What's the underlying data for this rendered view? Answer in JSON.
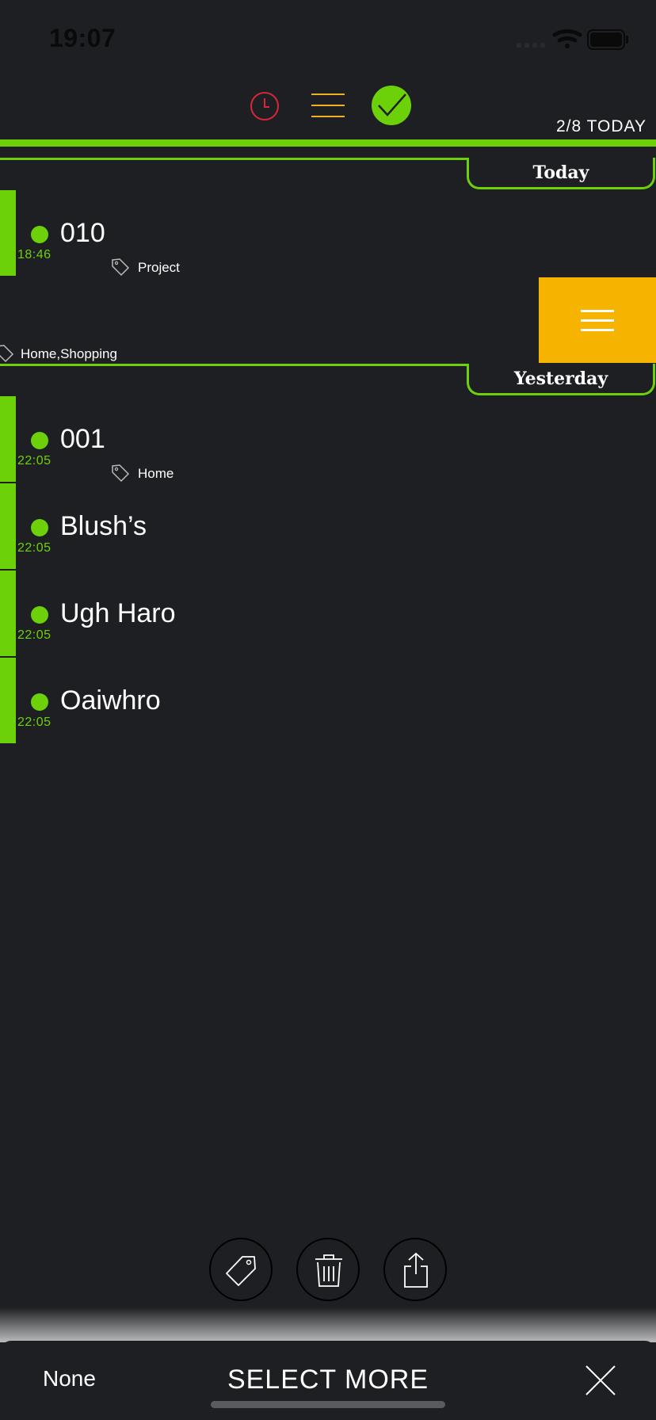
{
  "status_bar": {
    "time": "19:07"
  },
  "header": {
    "icons": [
      "clock-icon",
      "list-icon",
      "check-icon"
    ],
    "counter": "2/8 TODAY",
    "colors": {
      "accent": "#6dd10a",
      "clock": "#d9263a",
      "list": "#f0b020",
      "swipe": "#f6b400",
      "background": "#1e1f22"
    }
  },
  "sections": [
    {
      "label": "Today"
    },
    {
      "label": "Yesterday"
    }
  ],
  "today_items": [
    {
      "title": "010",
      "time": "18:46",
      "tags": "Project"
    }
  ],
  "swiped_item": {
    "tags": "Home,Shopping",
    "action_icon": "menu-icon"
  },
  "yesterday_items": [
    {
      "title": "001",
      "time": "22:05",
      "tags": "Home"
    },
    {
      "title": "Blush’s",
      "time": "22:05",
      "tags": ""
    },
    {
      "title": "Ugh Haro",
      "time": "22:05",
      "tags": ""
    },
    {
      "title": "Oaiwhro",
      "time": "22:05",
      "tags": ""
    }
  ],
  "actions": [
    "tag-icon",
    "trash-icon",
    "share-icon"
  ],
  "bottom_bar": {
    "none_label": "None",
    "select_more_label": "SELECT MORE",
    "close_icon": "close-icon"
  }
}
